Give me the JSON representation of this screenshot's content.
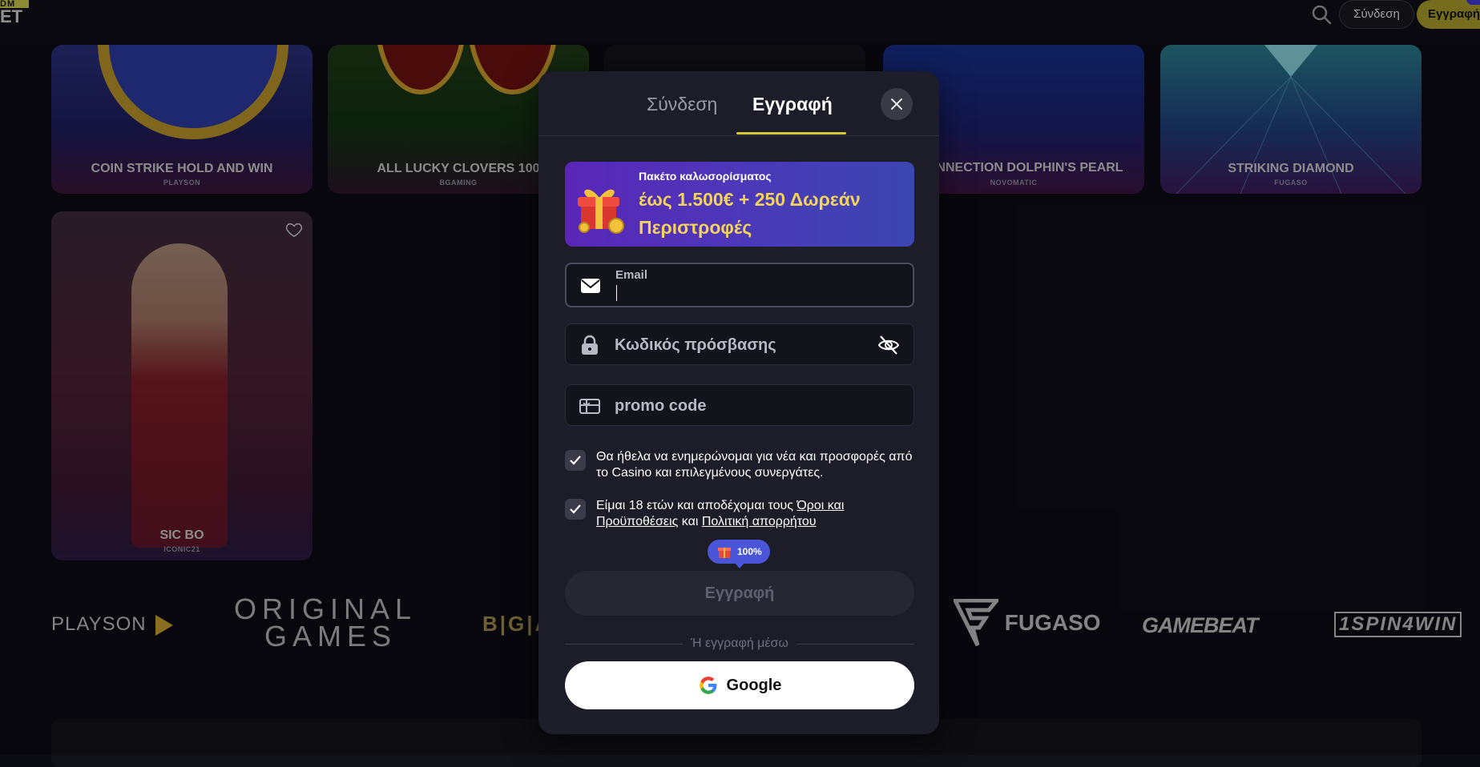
{
  "header": {
    "logo_top": "DM",
    "logo_bottom": "ET",
    "login_label": "Σύνδεση",
    "register_label": "Εγγραφή"
  },
  "games": [
    {
      "title": "COIN STRIKE HOLD AND WIN",
      "provider": "PLAYSON"
    },
    {
      "title": "ALL LUCKY CLOVERS 100",
      "provider": "BGAMING"
    },
    {
      "title": "",
      "provider": ""
    },
    {
      "title": "H CONNECTION DOLPHIN'S PEARL",
      "provider": "NOVOMATIC"
    },
    {
      "title": "STRIKING DIAMOND",
      "provider": "FUGASO"
    },
    {
      "title": "SIC BO",
      "provider": "ICONIC21"
    }
  ],
  "providers": {
    "playson": "PLAYSON",
    "original_line1": "ORIGINAL",
    "original_line2": "GAMES",
    "bgaming": "B|G|A",
    "fugaso": "FUGASO",
    "gamebeat": "GAMEBEAT",
    "onespin": "1SPIN4WIN"
  },
  "modal": {
    "tab_login": "Σύνδεση",
    "tab_register": "Εγγραφή",
    "promo": {
      "small": "Πακέτο καλωσορίσματος",
      "big": "έως 1.500€ + 250 Δωρεάν Περιστροφές"
    },
    "email_label": "Email",
    "email_value": "",
    "password_placeholder": "Κωδικός πρόσβασης",
    "promo_placeholder": "promo code",
    "check1_text": "Θα ήθελα να ενημερώνομαι για νέα και προσφορές από το Casino και επιλεγμένους συνεργάτες.",
    "check2_pre": "Είμαι 18 ετών και αποδέχομαι τους ",
    "check2_link1": "Όροι και Προϋποθέσεις",
    "check2_mid": " και ",
    "check2_link2": "Πολιτική απορρήτου",
    "badge": "100%",
    "submit_label": "Εγγραφή",
    "divider_text": "Ή εγγραφή μέσω",
    "google_label": "Google"
  },
  "colors": {
    "accent": "#d7c833",
    "modal_bg": "#1d1d29",
    "promo_gold": "#f3d35a",
    "badge_blue": "#4a55d8"
  }
}
